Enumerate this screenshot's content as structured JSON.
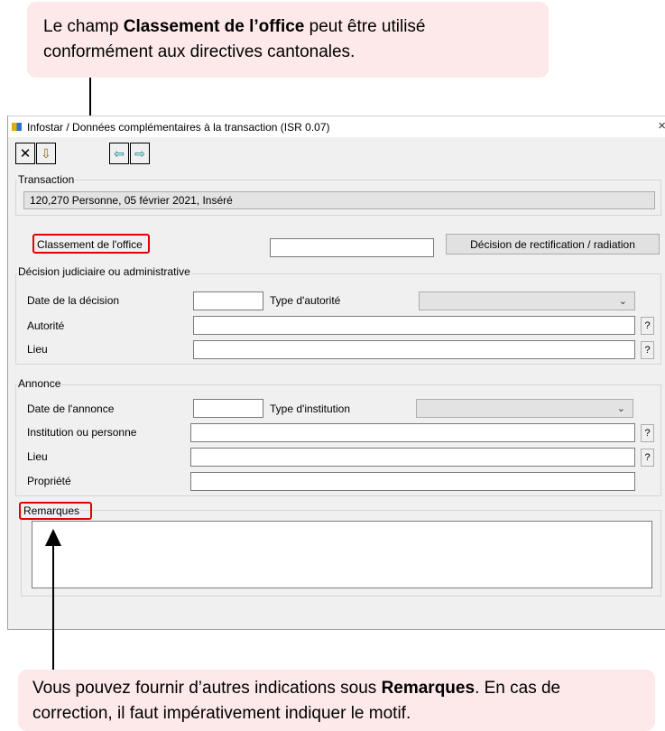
{
  "callouts": {
    "top_pre": "Le champ ",
    "top_bold": "Classement de l’office",
    "top_post": " peut être utilisé conformément aux directives cantonales.",
    "bottom_pre": "Vous pouvez fournir d’autres indications sous ",
    "bottom_bold": "Remarques",
    "bottom_post": ". En cas de correction, il faut impérativement indiquer le motif."
  },
  "window": {
    "title": "Infostar / Données complémentaires à la transaction (ISR 0.07)",
    "close_glyph": "×"
  },
  "toolbar": {
    "cancel_glyph": "✕",
    "save_glyph": "⇩",
    "prev_glyph": "⇦",
    "next_glyph": "⇨"
  },
  "transaction": {
    "label": "Transaction",
    "value": "120,270  Personne, 05 février 2021, Inséré"
  },
  "office": {
    "label": "Classement de l'office",
    "value": "",
    "button": "Décision de rectification / radiation"
  },
  "decision": {
    "label": "Décision judiciaire ou administrative",
    "date_label": "Date de la décision",
    "authority_type_label": "Type d'autorité",
    "authority_type_value": "",
    "authority_label": "Autorité",
    "place_label": "Lieu",
    "help": "?"
  },
  "announcement": {
    "label": "Annonce",
    "date_label": "Date de l'annonce",
    "institution_type_label": "Type d'institution",
    "institution_type_value": "",
    "institution_label": "Institution ou personne",
    "place_label": "Lieu",
    "property_label": "Propriété",
    "help": "?"
  },
  "remarks": {
    "label": "Remarques",
    "value": ""
  },
  "colors": {
    "callout_bg": "#fde9ea",
    "highlight": "#e00000",
    "window_bg": "#f0f0f0"
  }
}
